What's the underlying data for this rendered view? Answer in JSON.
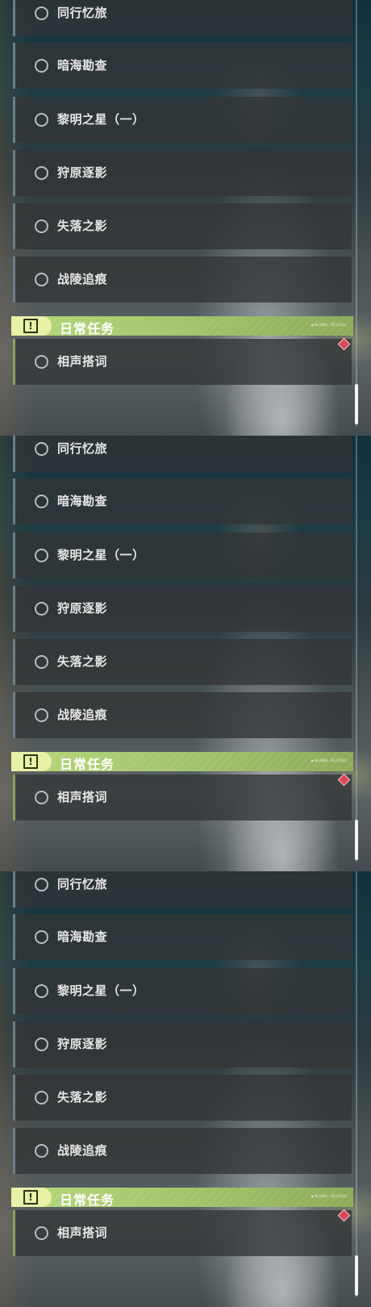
{
  "screenshots": [
    {
      "quests": [
        "同行忆旅",
        "暗海勘查",
        "黎明之星（一）",
        "狩原逐影",
        "失落之影",
        "战陵追痕"
      ],
      "category": {
        "label": "日常任务",
        "icon": "exclamation-icon",
        "note": "◆ 每日刷新，明日可再次"
      },
      "daily_quests": [
        "相声搭词"
      ],
      "marker": "red-diamond-icon"
    },
    {
      "quests": [
        "同行忆旅",
        "暗海勘查",
        "黎明之星（一）",
        "狩原逐影",
        "失落之影",
        "战陵追痕"
      ],
      "category": {
        "label": "日常任务",
        "icon": "exclamation-icon",
        "note": "◆ 每日刷新，明日可再次"
      },
      "daily_quests": [
        "相声搭词"
      ],
      "marker": "red-diamond-icon"
    },
    {
      "quests": [
        "同行忆旅",
        "暗海勘查",
        "黎明之星（一）",
        "狩原逐影",
        "失落之影",
        "战陵追痕"
      ],
      "category": {
        "label": "日常任务",
        "icon": "exclamation-icon",
        "note": "◆ 每日刷新，明日可再次"
      },
      "daily_quests": [
        "相声搭词"
      ],
      "marker": "red-diamond-icon"
    }
  ],
  "colors": {
    "category_bar": "#a4c56c",
    "category_icon_bg": "#e8f1a6",
    "quest_bg": "#323436",
    "marker": "#d8465a"
  }
}
